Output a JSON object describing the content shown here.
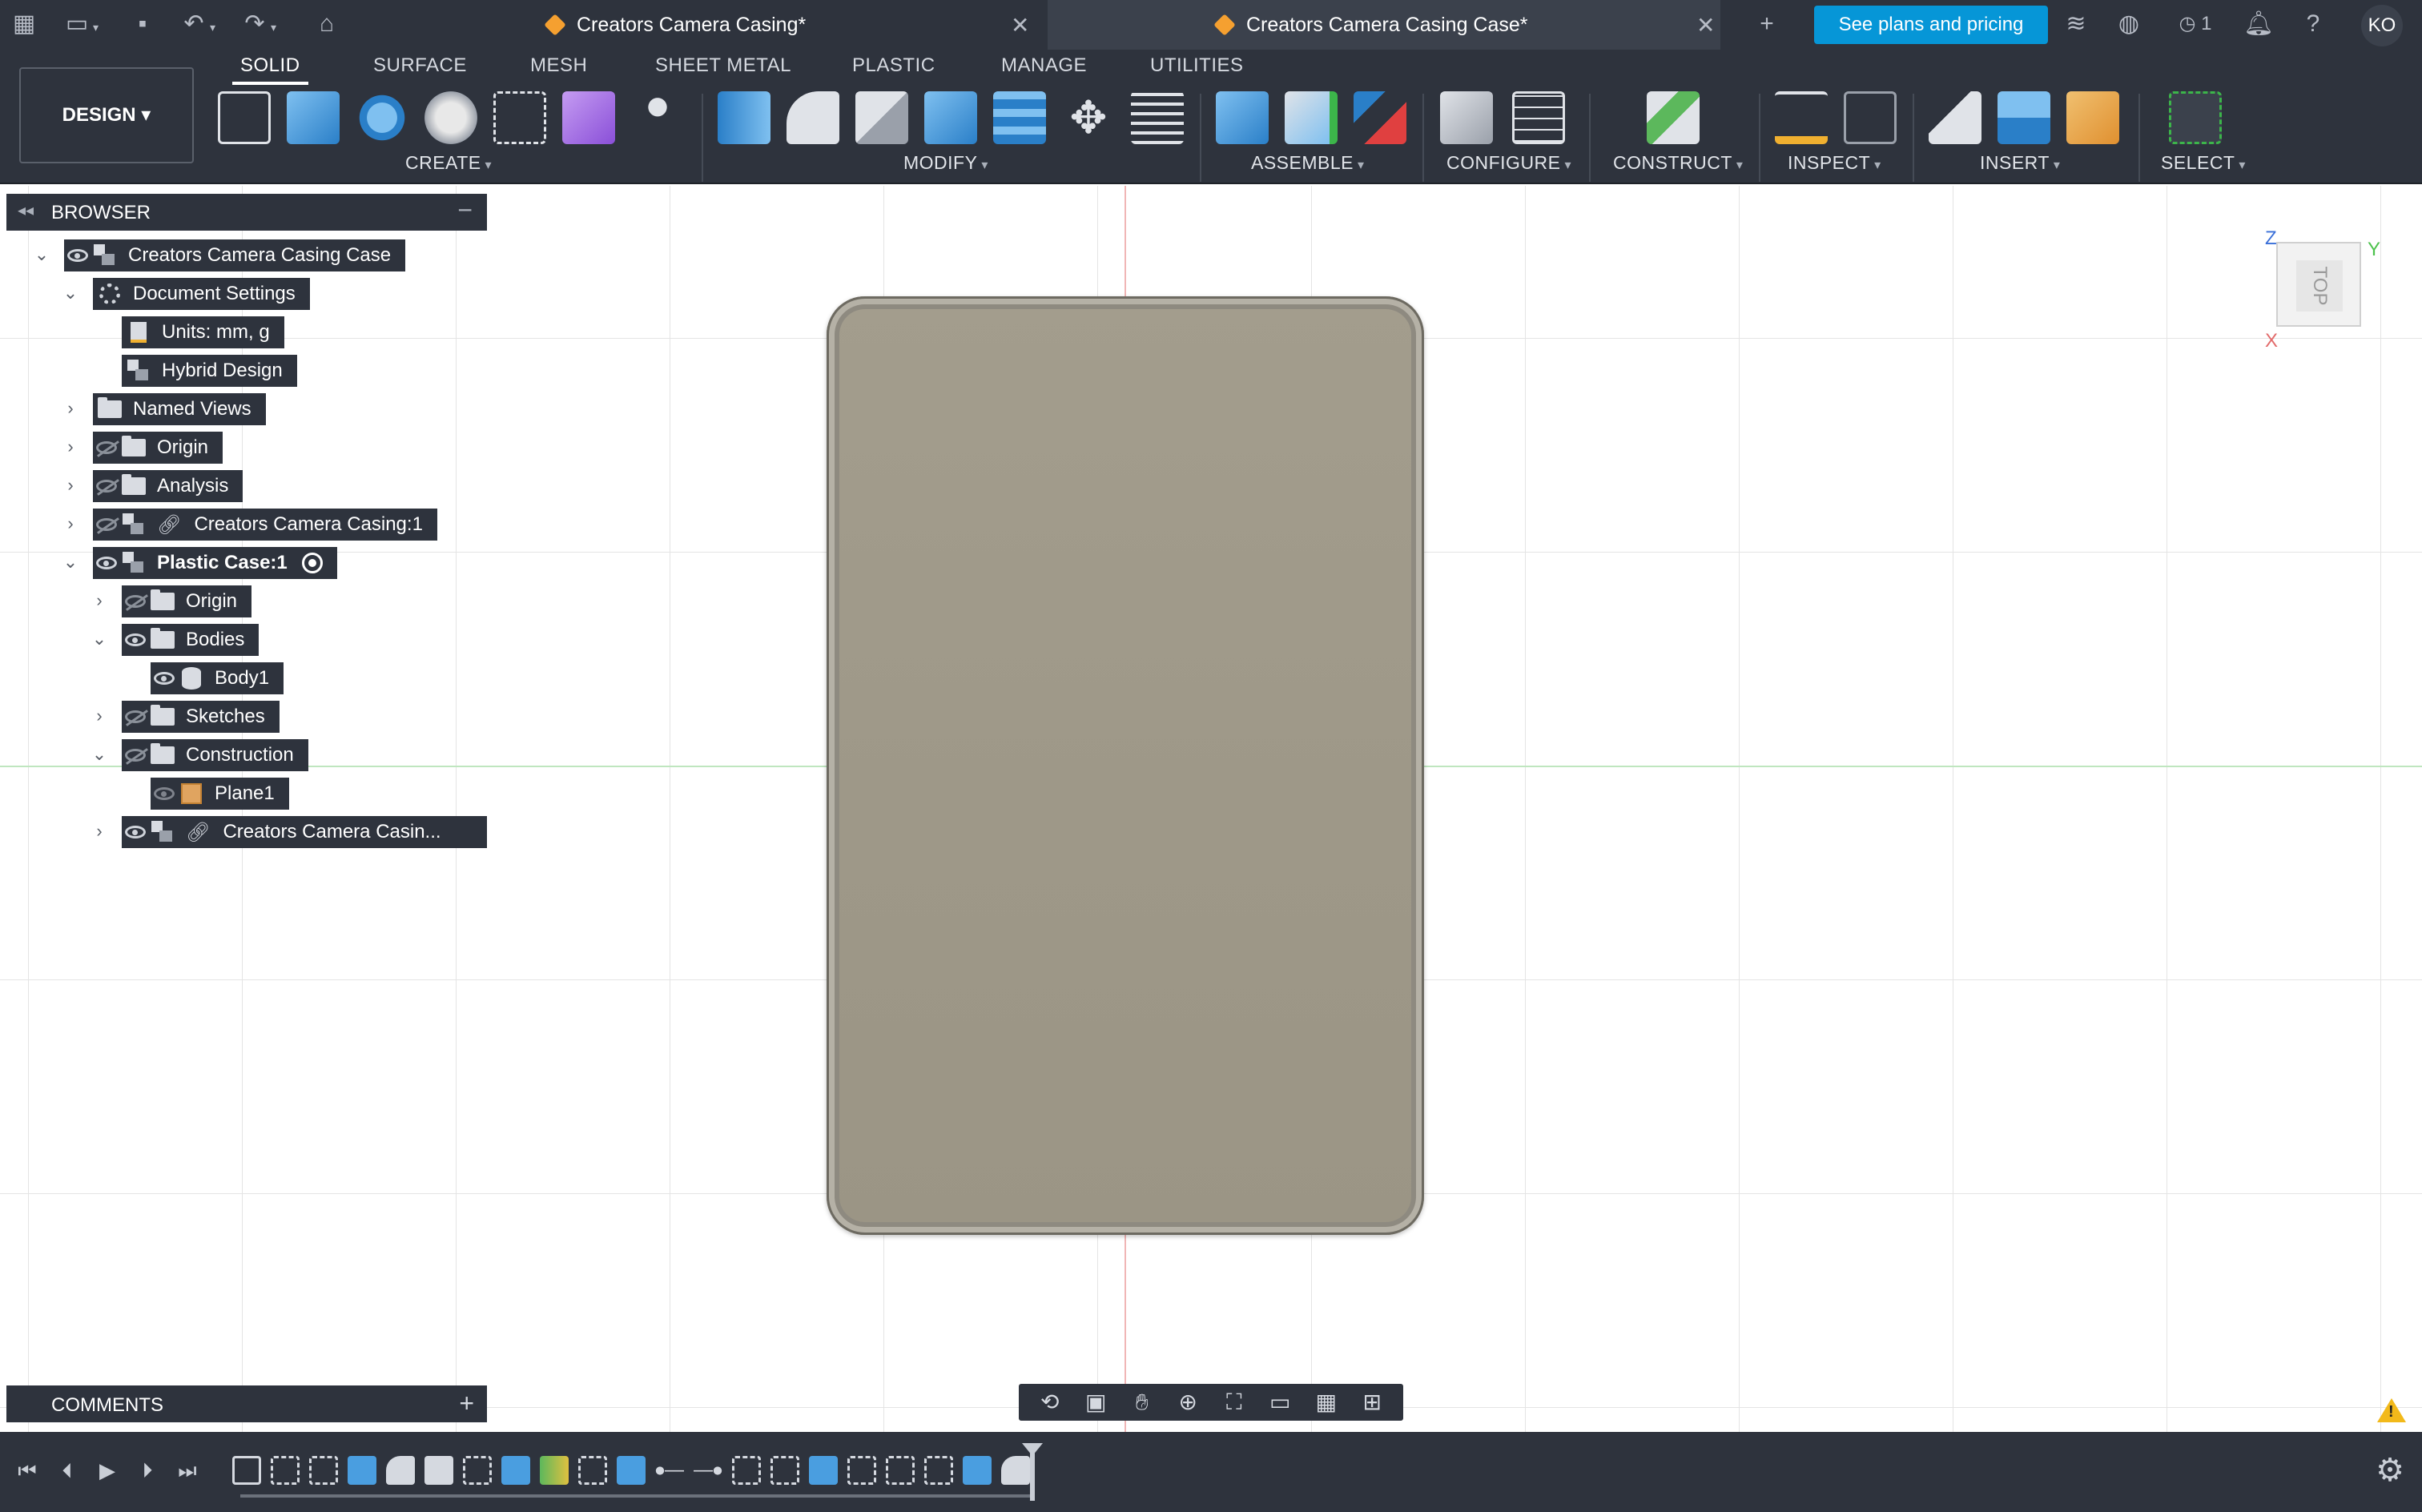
{
  "titlebar": {
    "tab1_label": "Creators Camera Casing*",
    "tab2_label": "Creators Camera Casing Case*",
    "plans_button": "See plans and pricing",
    "job_count": "1",
    "user_initials": "KO"
  },
  "ribbon": {
    "workspace": "DESIGN",
    "tabs": [
      "SOLID",
      "SURFACE",
      "MESH",
      "SHEET METAL",
      "PLASTIC",
      "MANAGE",
      "UTILITIES"
    ],
    "active_tab": "SOLID",
    "groups": [
      "CREATE",
      "MODIFY",
      "ASSEMBLE",
      "CONFIGURE",
      "CONSTRUCT",
      "INSPECT",
      "INSERT",
      "SELECT"
    ]
  },
  "browser": {
    "title": "BROWSER",
    "nodes": [
      {
        "label": "Creators Camera Casing Case"
      },
      {
        "label": "Document Settings"
      },
      {
        "label": "Units: mm, g"
      },
      {
        "label": "Hybrid Design"
      },
      {
        "label": "Named Views"
      },
      {
        "label": "Origin"
      },
      {
        "label": "Analysis"
      },
      {
        "label": "Creators Camera Casing:1"
      },
      {
        "label": "Plastic Case:1"
      },
      {
        "label": "Origin"
      },
      {
        "label": "Bodies"
      },
      {
        "label": "Body1"
      },
      {
        "label": "Sketches"
      },
      {
        "label": "Construction"
      },
      {
        "label": "Plane1"
      },
      {
        "label": "Creators Camera Casin..."
      }
    ]
  },
  "comments": {
    "title": "COMMENTS"
  },
  "viewcube": {
    "face": "TOP",
    "axis_z": "Z",
    "axis_y": "Y",
    "axis_x": "X"
  },
  "colors": {
    "chrome": "#2e333d",
    "accent": "#0696d7",
    "body": "#a39d8d",
    "axis_red": "#e26a6a",
    "axis_green": "#4cc24c"
  }
}
